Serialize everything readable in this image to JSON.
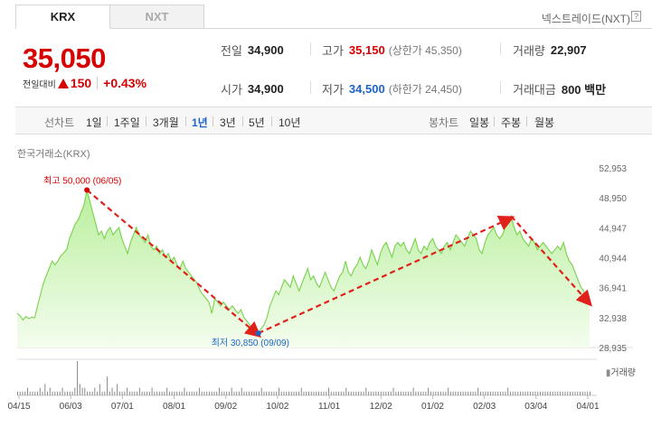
{
  "tabs": [
    {
      "label": "KRX",
      "active": true
    },
    {
      "label": "NXT",
      "active": false
    }
  ],
  "header": {
    "nxt_link": "넥스트레이드(NXT)",
    "help_icon": "?"
  },
  "quote": {
    "price": "35,050",
    "change_label": "전일대비",
    "change_value": "150",
    "change_percent": "+0.43%",
    "change_direction": "up"
  },
  "stats": {
    "prev_close": {
      "label": "전일",
      "value": "34,900"
    },
    "high": {
      "label": "고가",
      "value": "35,150",
      "sub": "(상한가 45,350)"
    },
    "volume": {
      "label": "거래량",
      "value": "22,907"
    },
    "open": {
      "label": "시가",
      "value": "34,900"
    },
    "low": {
      "label": "저가",
      "value": "34,500",
      "sub": "(하한가 24,450)"
    },
    "amount": {
      "label": "거래대금",
      "value": "800 백만"
    }
  },
  "period_bar": {
    "line_label": "선차트",
    "periods": [
      "1일",
      "1주일",
      "3개월",
      "1년",
      "3년",
      "5년",
      "10년"
    ],
    "active_period": "1년",
    "candle_label": "봉차트",
    "candles": [
      "일봉",
      "주봉",
      "월봉"
    ]
  },
  "chart_source": "한국거래소(KRX)",
  "volume_legend": "거래량",
  "chart_data": {
    "type": "area",
    "title": "",
    "y_ticks": [
      "52,953",
      "48,950",
      "44,947",
      "40,944",
      "36,941",
      "32,938",
      "28,935"
    ],
    "ylim": [
      28935,
      52953
    ],
    "x_ticks": [
      "04/15",
      "06/03",
      "07/01",
      "08/01",
      "09/02",
      "10/02",
      "11/01",
      "12/02",
      "01/02",
      "02/03",
      "03/04",
      "04/01"
    ],
    "annotations": {
      "high": {
        "label": "최고 50,000 (06/05)",
        "value": 50000
      },
      "low": {
        "label": "최저 30,850 (09/09)",
        "value": 30850
      }
    },
    "series": [
      {
        "values": [
          33500,
          33200,
          32600,
          33100,
          32800,
          33000,
          32900,
          34500,
          36000,
          37500,
          38500,
          39500,
          40500,
          40000,
          40500,
          41200,
          41600,
          42000,
          43500,
          44500,
          45500,
          46000,
          47000,
          48000,
          50000,
          48500,
          47000,
          45500,
          44000,
          44500,
          43500,
          44500,
          45000,
          44000,
          44500,
          45000,
          43500,
          42500,
          41500,
          43000,
          44000,
          45000,
          44000,
          43500,
          43000,
          44000,
          42500,
          42000,
          42500,
          41500,
          42000,
          41000,
          41500,
          40500,
          41000,
          40000,
          39500,
          40500,
          39500,
          39000,
          38500,
          38000,
          37500,
          36500,
          36000,
          35500,
          35000,
          33500,
          35500,
          35000,
          34500,
          35000,
          34500,
          34000,
          34500,
          34000,
          33500,
          34000,
          33000,
          32500,
          32000,
          31500,
          31000,
          30850,
          31500,
          32000,
          33000,
          34500,
          35500,
          36500,
          36000,
          37000,
          38000,
          37500,
          37000,
          38500,
          37500,
          36500,
          37500,
          38500,
          39500,
          38000,
          38500,
          37500,
          37000,
          38000,
          39000,
          38000,
          37000,
          36500,
          37500,
          38500,
          39000,
          40500,
          39000,
          38500,
          39500,
          40000,
          41000,
          40000,
          39500,
          40500,
          42000,
          41000,
          40000,
          41500,
          42500,
          43000,
          42000,
          41000,
          42500,
          43000,
          42500,
          43000,
          42000,
          41500,
          42500,
          43500,
          42000,
          41500,
          42500,
          42000,
          43000,
          43500,
          42500,
          42000,
          41500,
          42500,
          43000,
          42000,
          43000,
          44000,
          43500,
          43000,
          42500,
          43500,
          44500,
          44000,
          43500,
          42000,
          41500,
          43000,
          44000,
          44500,
          45000,
          44000,
          43500,
          44000,
          45000,
          45500,
          46500,
          45000,
          44000,
          44500,
          43500,
          43000,
          42500,
          43500,
          43000,
          42000,
          42500,
          43000,
          42500,
          42000,
          41500,
          42000,
          42500,
          42000,
          43000,
          41500,
          40500,
          40000,
          39000,
          38000,
          37000,
          36500,
          35000,
          35050
        ]
      }
    ]
  },
  "volume_data": [
    1,
    1,
    1,
    1,
    2,
    1,
    1,
    1,
    1,
    2,
    1,
    3,
    1,
    2,
    1,
    1,
    1,
    1,
    2,
    1,
    1,
    1,
    1,
    2,
    9,
    3,
    2,
    2,
    1,
    1,
    1,
    2,
    1,
    3,
    1,
    1,
    5,
    1,
    2,
    1,
    3,
    1,
    1,
    1,
    2,
    1,
    1,
    1,
    1,
    2,
    1,
    1,
    1,
    1,
    2,
    1,
    1,
    1,
    1,
    1,
    2,
    1,
    1,
    1,
    1,
    1,
    1,
    2,
    1,
    1,
    1,
    1,
    1,
    2,
    1,
    1,
    1,
    1,
    1,
    1,
    1,
    2,
    1,
    1,
    1,
    1,
    2,
    1,
    1,
    1,
    2,
    1,
    1,
    1,
    1,
    1,
    1,
    1,
    2,
    1,
    1,
    1,
    1,
    1,
    1,
    2,
    1,
    1,
    1,
    1,
    1,
    1,
    1,
    1,
    2,
    1,
    1,
    1,
    1,
    1,
    1,
    1,
    1,
    1,
    1,
    2,
    1,
    1,
    1,
    1,
    1,
    1,
    2,
    1,
    1,
    1,
    1,
    1,
    1,
    1,
    2,
    1,
    1,
    1,
    1,
    1,
    1,
    1,
    1,
    1,
    1,
    2,
    1,
    1,
    1,
    1,
    1,
    1,
    1,
    2,
    1,
    1,
    1,
    1,
    1,
    2,
    1,
    1,
    1,
    1,
    1,
    1,
    1,
    2,
    1,
    1,
    1,
    1,
    1,
    1,
    1,
    1,
    1,
    1,
    1,
    2,
    1,
    1,
    1,
    1,
    1,
    1,
    1,
    1,
    1,
    1,
    1,
    2,
    1,
    1,
    1,
    1,
    1,
    1,
    1,
    1,
    1,
    1,
    1,
    1,
    1,
    1,
    1,
    1,
    1,
    1,
    1,
    1,
    1,
    1,
    1,
    1,
    1,
    1,
    1,
    1,
    1,
    1,
    1,
    1,
    1
  ]
}
